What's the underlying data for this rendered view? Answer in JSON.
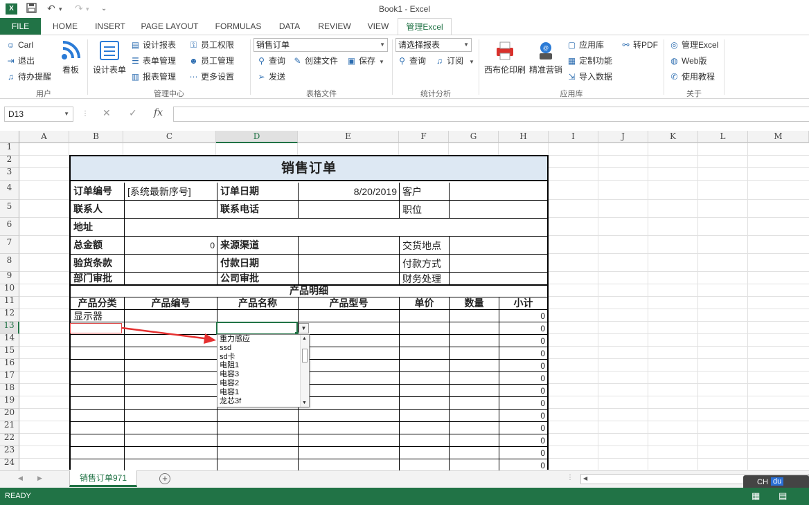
{
  "window": {
    "title": "Book1 - Excel"
  },
  "tabs": [
    "HOME",
    "INSERT",
    "PAGE LAYOUT",
    "FORMULAS",
    "DATA",
    "REVIEW",
    "VIEW"
  ],
  "file_tab": "FILE",
  "active_tab": "管理Excel",
  "ribbon": {
    "user": {
      "name": "Carl",
      "logout": "退出",
      "todo": "待办提醒",
      "board": "看板",
      "group": "用户"
    },
    "mgmt": {
      "design_form": "设计表单",
      "design_report": "设计报表",
      "form_mgmt": "表单管理",
      "report_mgmt": "报表管理",
      "emp_perm": "员工权限",
      "emp_mgmt": "员工管理",
      "more": "更多设置",
      "group": "管理中心"
    },
    "tablefile": {
      "combo": "销售订单",
      "query": "查询",
      "create": "创建文件",
      "save": "保存",
      "send": "发送",
      "group": "表格文件"
    },
    "stats": {
      "combo": "请选择报表",
      "query": "查询",
      "subscribe": "订阅",
      "group": "统计分析"
    },
    "apps": {
      "print": "西布伦印刷",
      "marketing": "精准营销",
      "appstore": "应用库",
      "custom": "定制功能",
      "import": "导入数据",
      "topdf": "转PDF",
      "group": "应用库"
    },
    "about": {
      "manage": "管理Excel",
      "web": "Web版",
      "tutorial": "使用教程",
      "group": "关于"
    }
  },
  "namebox": "D13",
  "columns": [
    "A",
    "B",
    "C",
    "D",
    "E",
    "F",
    "G",
    "H",
    "I",
    "J",
    "K",
    "L",
    "M"
  ],
  "rows": [
    "1",
    "2",
    "3",
    "4",
    "5",
    "6",
    "7",
    "8",
    "9",
    "10",
    "11",
    "12",
    "13",
    "14",
    "15",
    "16",
    "17",
    "18",
    "19",
    "20",
    "21",
    "22",
    "23",
    "24"
  ],
  "form": {
    "title": "销售订单",
    "order_no_label": "订单编号",
    "order_no_value": "[系统最新序号]",
    "order_date_label": "订单日期",
    "order_date_value": "8/20/2019",
    "customer_label": "客户",
    "contact_label": "联系人",
    "phone_label": "联系电话",
    "position_label": "职位",
    "address_label": "地址",
    "total_label": "总金额",
    "total_value": "0",
    "source_label": "来源渠道",
    "delivery_label": "交货地点",
    "inspect_label": "验货条款",
    "paydate_label": "付款日期",
    "paymethod_label": "付款方式",
    "dept_label": "部门审批",
    "company_label": "公司审批",
    "finance_label": "财务处理",
    "detail_title": "产品明细",
    "detail_headers": [
      "产品分类",
      "产品编号",
      "产品名称",
      "产品型号",
      "单价",
      "数量",
      "小计"
    ],
    "first_category": "显示器",
    "subtotals": [
      "0",
      "0",
      "0",
      "0",
      "0",
      "0",
      "0",
      "0",
      "0",
      "0",
      "0",
      "0",
      "0"
    ]
  },
  "dropdown": {
    "items": [
      "重力感应",
      "ssd",
      "sd卡",
      "电阻1",
      "电容3",
      "电容2",
      "电容1",
      "龙芯3f"
    ]
  },
  "sheet_tab": "销售订单971",
  "status": "READY",
  "ime": {
    "ch": "CH",
    "du": "du"
  }
}
